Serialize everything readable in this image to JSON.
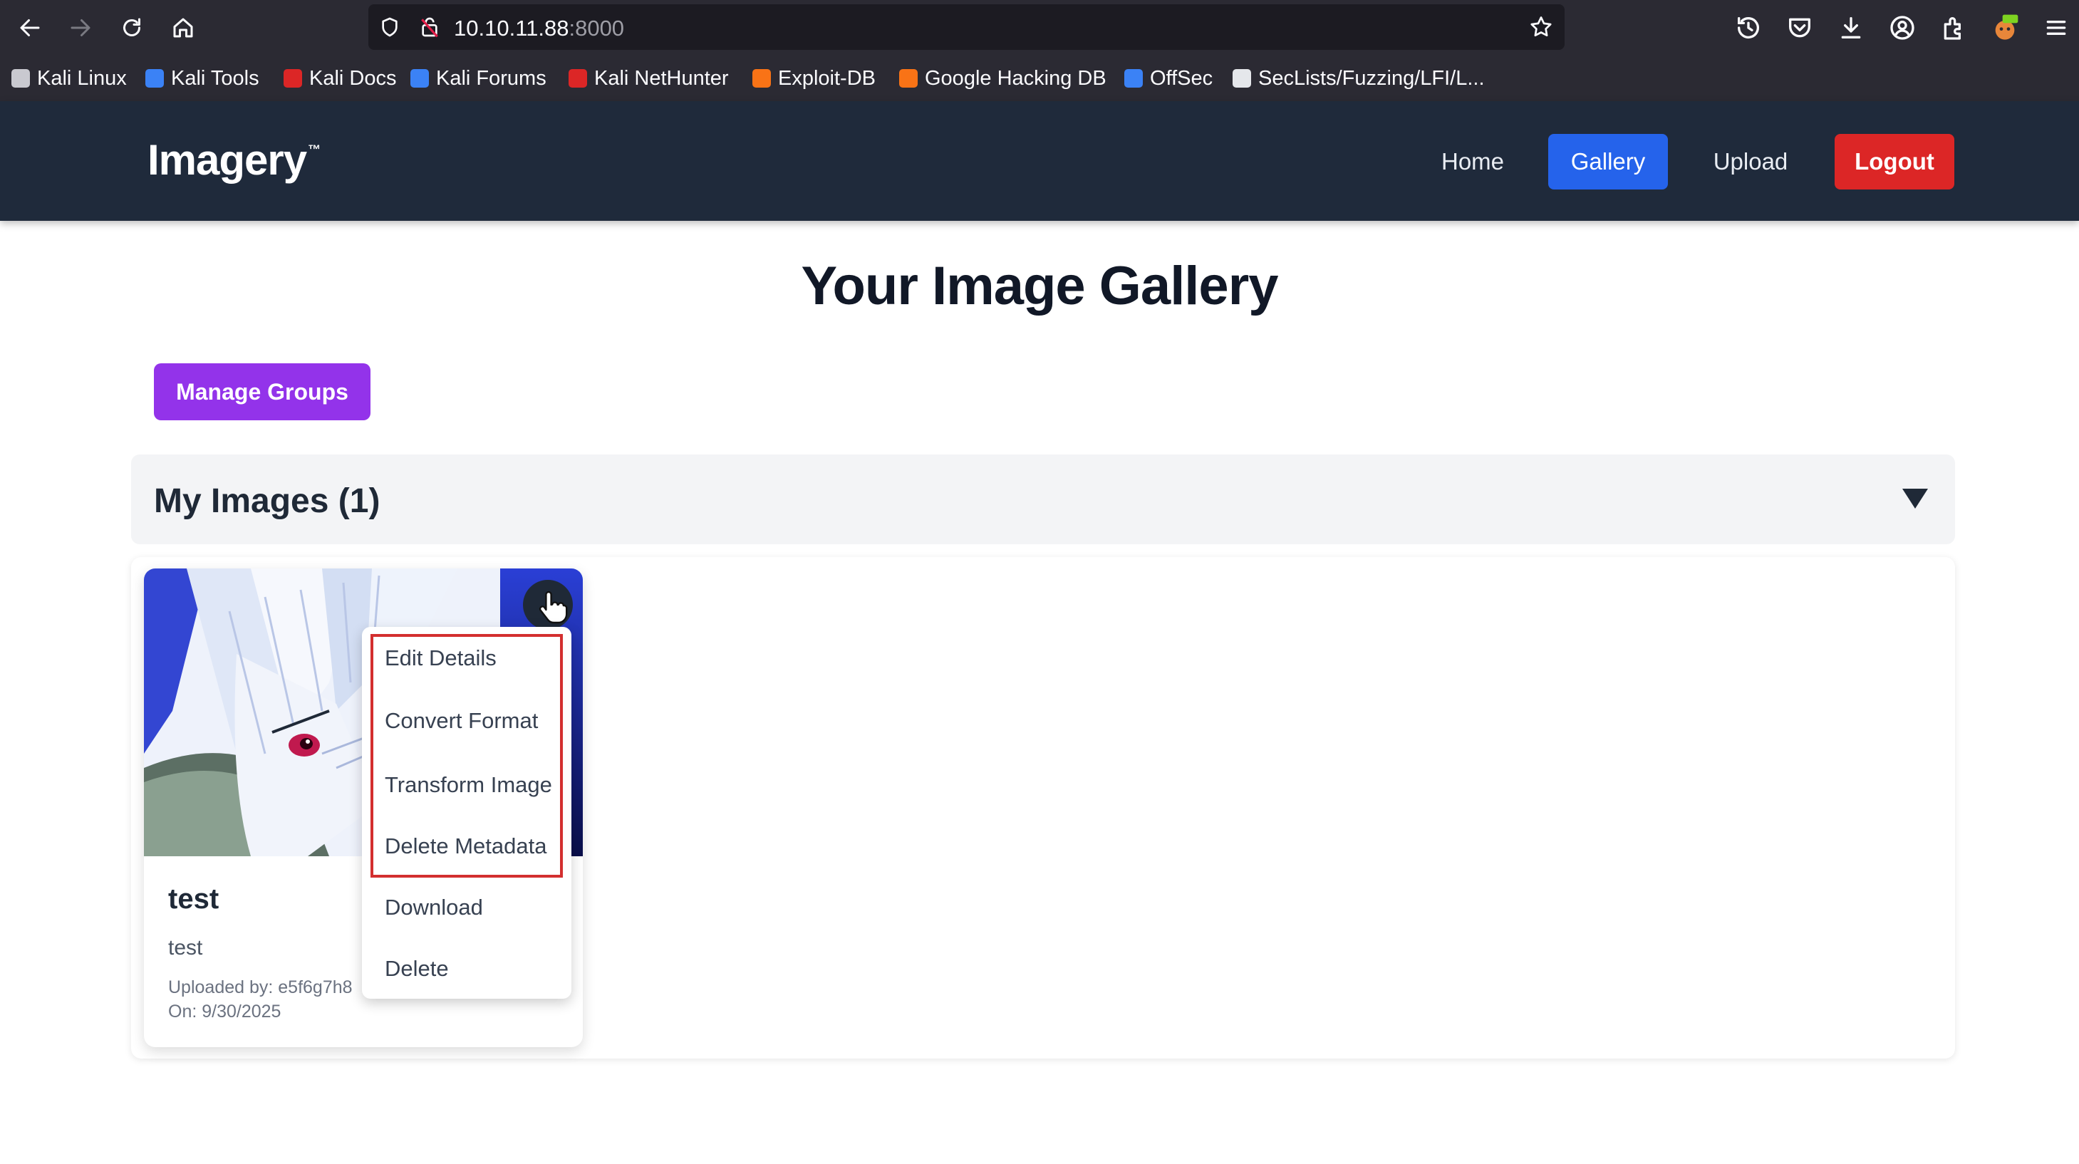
{
  "browser": {
    "url_host": "10.10.11.88",
    "url_port": ":8000",
    "bookmarks": [
      {
        "label": "Kali Linux",
        "icon": "kali-dragon-icon",
        "color": "#c9c9d0"
      },
      {
        "label": "Kali Tools",
        "icon": "kali-tools-icon",
        "color": "#3b82f6"
      },
      {
        "label": "Kali Docs",
        "icon": "kali-docs-icon",
        "color": "#dc2626"
      },
      {
        "label": "Kali Forums",
        "icon": "kali-forums-icon",
        "color": "#3b82f6"
      },
      {
        "label": "Kali NetHunter",
        "icon": "nethunter-icon",
        "color": "#dc2626"
      },
      {
        "label": "Exploit-DB",
        "icon": "exploit-db-icon",
        "color": "#f97316"
      },
      {
        "label": "Google Hacking DB",
        "icon": "ghdb-icon",
        "color": "#f97316"
      },
      {
        "label": "OffSec",
        "icon": "offsec-icon",
        "color": "#3b82f6"
      },
      {
        "label": "SecLists/Fuzzing/LFI/L...",
        "icon": "github-icon",
        "color": "#e5e7eb"
      }
    ]
  },
  "site": {
    "brand": "Imagery",
    "brand_mark": "™",
    "nav": {
      "home": "Home",
      "gallery": "Gallery",
      "upload": "Upload",
      "logout": "Logout"
    },
    "colors": {
      "header_bg": "#1f2a3b",
      "active_nav": "#2563eb",
      "logout": "#dc2626",
      "manage_groups": "#9333ea",
      "highlight": "#d32f2f"
    }
  },
  "page": {
    "title": "Your Image Gallery",
    "manage_groups": "Manage Groups",
    "section_title": "My Images (1)",
    "section_toggle_icon": "triangle-down-icon"
  },
  "card": {
    "title": "test",
    "description": "test",
    "uploaded_by": "Uploaded by: e5f6g7h8",
    "date": "On: 9/30/2025"
  },
  "menu": {
    "items": [
      "Edit Details",
      "Convert Format",
      "Transform Image",
      "Delete Metadata",
      "Download",
      "Delete"
    ]
  }
}
